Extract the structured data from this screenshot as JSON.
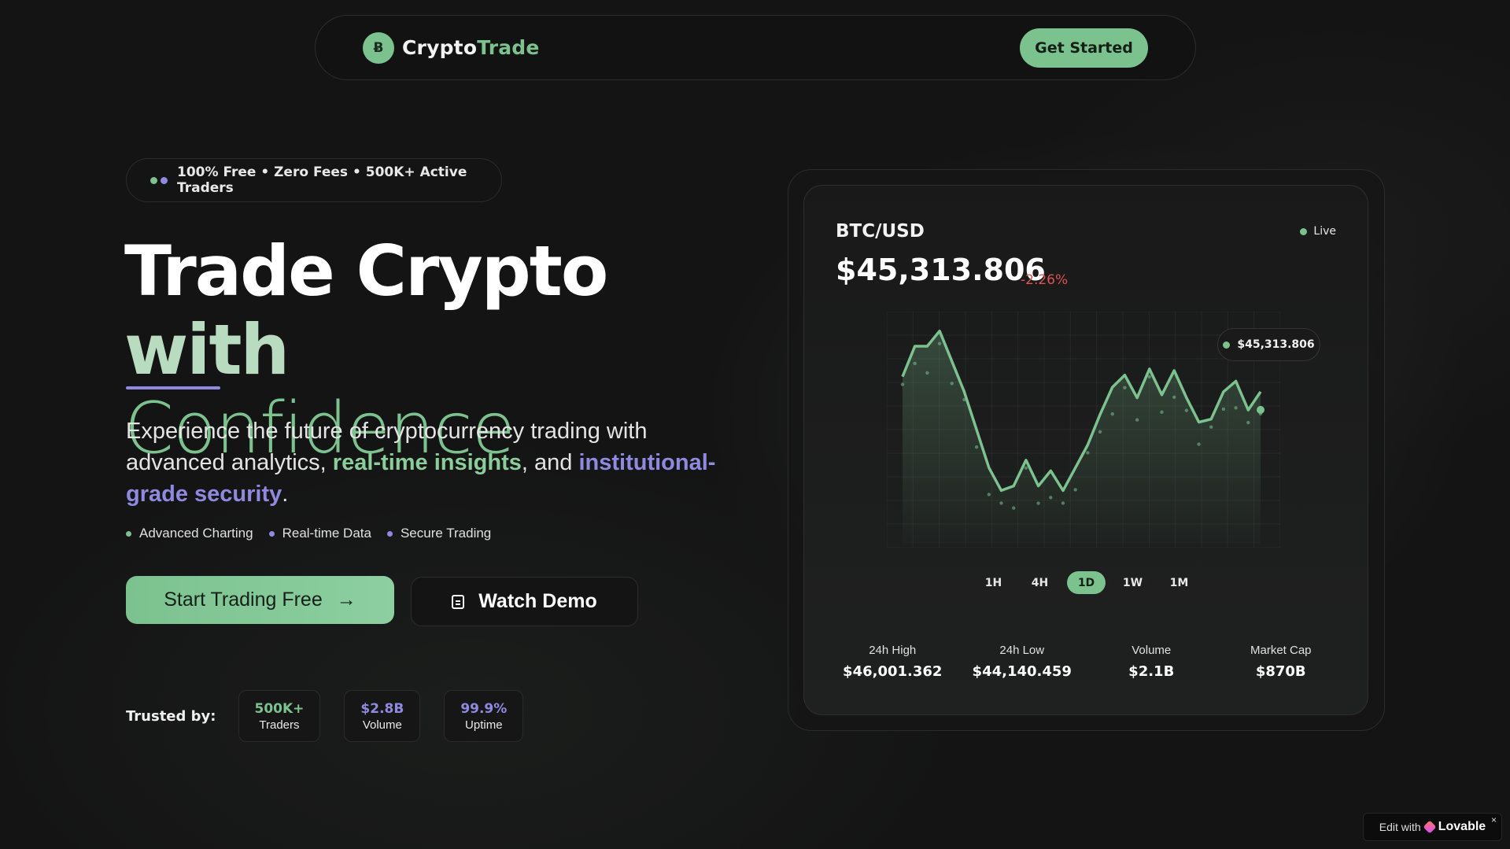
{
  "navbar": {
    "logo_glyph": "Ƀ",
    "brand_main": "Crypto",
    "brand_accent": "Trade",
    "cta": "Get Started"
  },
  "hero": {
    "badge": "100% Free • Zero Fees • 500K+ Active Traders",
    "title_line1_main": "Trade Crypto ",
    "title_line1_accent": "with",
    "title_line2": "Confidence",
    "desc_part1": "Experience the future of cryptocurrency trading with advanced analytics, ",
    "desc_highlight1": "real-time insights",
    "desc_part2": ", and ",
    "desc_highlight2": "institutional-grade security",
    "desc_part3": ".",
    "features": [
      "Advanced Charting",
      "Real-time Data",
      "Secure Trading"
    ],
    "primary_button": "Start Trading Free",
    "primary_icon": "→",
    "secondary_button": "Watch Demo",
    "trusted_label": "Trusted by:",
    "stats": [
      {
        "value": "500K+",
        "label": "Traders"
      },
      {
        "value": "$2.8B",
        "label": "Volume"
      },
      {
        "value": "99.9%",
        "label": "Uptime"
      }
    ]
  },
  "card": {
    "pair": "BTC/USD",
    "live": "Live",
    "price": "$45,313.806",
    "change": "-2.26%",
    "tooltip": "$45,313.806",
    "timeframes": [
      "1H",
      "4H",
      "1D",
      "1W",
      "1M"
    ],
    "active_timeframe": "1D",
    "metrics": [
      {
        "label": "24h High",
        "value": "$46,001.362"
      },
      {
        "label": "24h Low",
        "value": "$44,140.459"
      },
      {
        "label": "Volume",
        "value": "$2.1B"
      },
      {
        "label": "Market Cap",
        "value": "$870B"
      }
    ]
  },
  "chart_data": {
    "type": "line",
    "series": [
      {
        "values": [
          45700,
          45900,
          45900,
          46000,
          45800,
          45600,
          45350,
          45100,
          44950,
          44980,
          45150,
          44980,
          45080,
          44950,
          45100,
          45250,
          45450,
          45630,
          45710,
          45560,
          45750,
          45580,
          45740,
          45560,
          45400,
          45420,
          45600,
          45670,
          45480,
          45600
        ]
      }
    ],
    "xlabel": "",
    "ylabel": "",
    "grid": true,
    "line_color": "#7cc28f",
    "ylim": [
      44600,
      46050
    ]
  },
  "footer_badge": {
    "prefix": "Edit with",
    "brand": "Lovable",
    "close": "×"
  },
  "colors": {
    "accent_green": "#7cc28f",
    "accent_purple": "#8f8ae0",
    "negative": "#e05252",
    "background": "#141414"
  }
}
